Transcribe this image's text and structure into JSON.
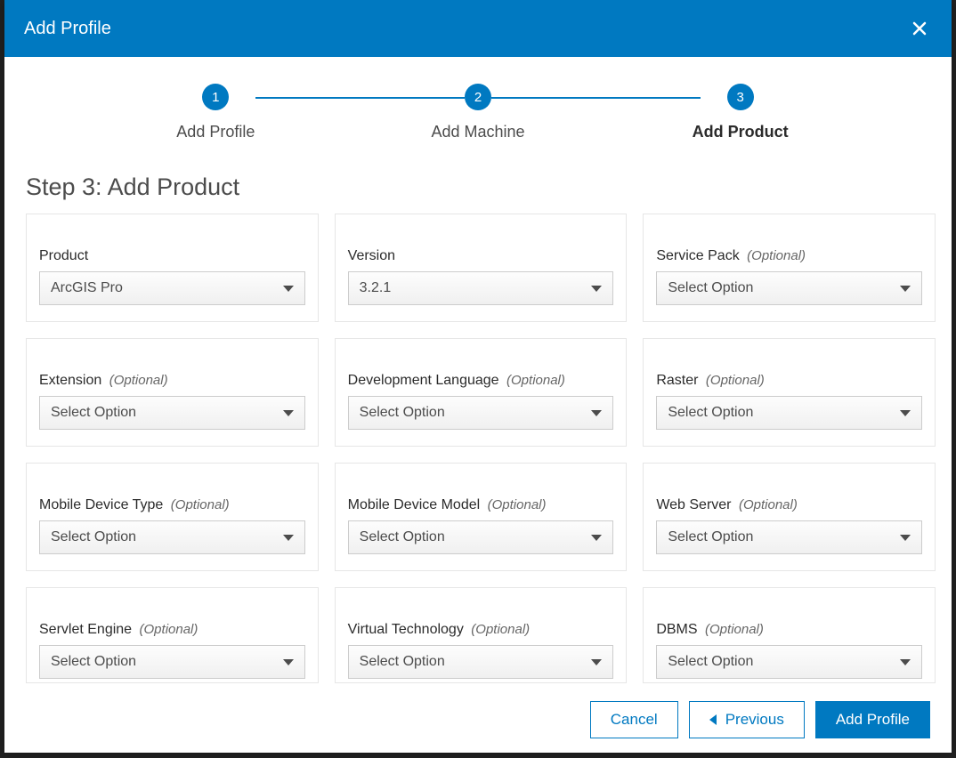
{
  "header": {
    "title": "Add Profile"
  },
  "stepper": {
    "step1": {
      "num": "1",
      "label": "Add Profile"
    },
    "step2": {
      "num": "2",
      "label": "Add Machine"
    },
    "step3": {
      "num": "3",
      "label": "Add Product"
    }
  },
  "heading": "Step 3: Add Product",
  "labels": {
    "product": "Product",
    "version": "Version",
    "service_pack": "Service Pack",
    "extension": "Extension",
    "dev_lang": "Development Language",
    "raster": "Raster",
    "mob_type": "Mobile Device Type",
    "mob_model": "Mobile Device Model",
    "web_server": "Web Server",
    "servlet": "Servlet Engine",
    "virtual": "Virtual Technology",
    "dbms": "DBMS",
    "optional": "(Optional)"
  },
  "values": {
    "product": "ArcGIS Pro",
    "version": "3.2.1",
    "placeholder": "Select Option"
  },
  "footer": {
    "cancel": "Cancel",
    "previous": "Previous",
    "add": "Add Profile"
  }
}
